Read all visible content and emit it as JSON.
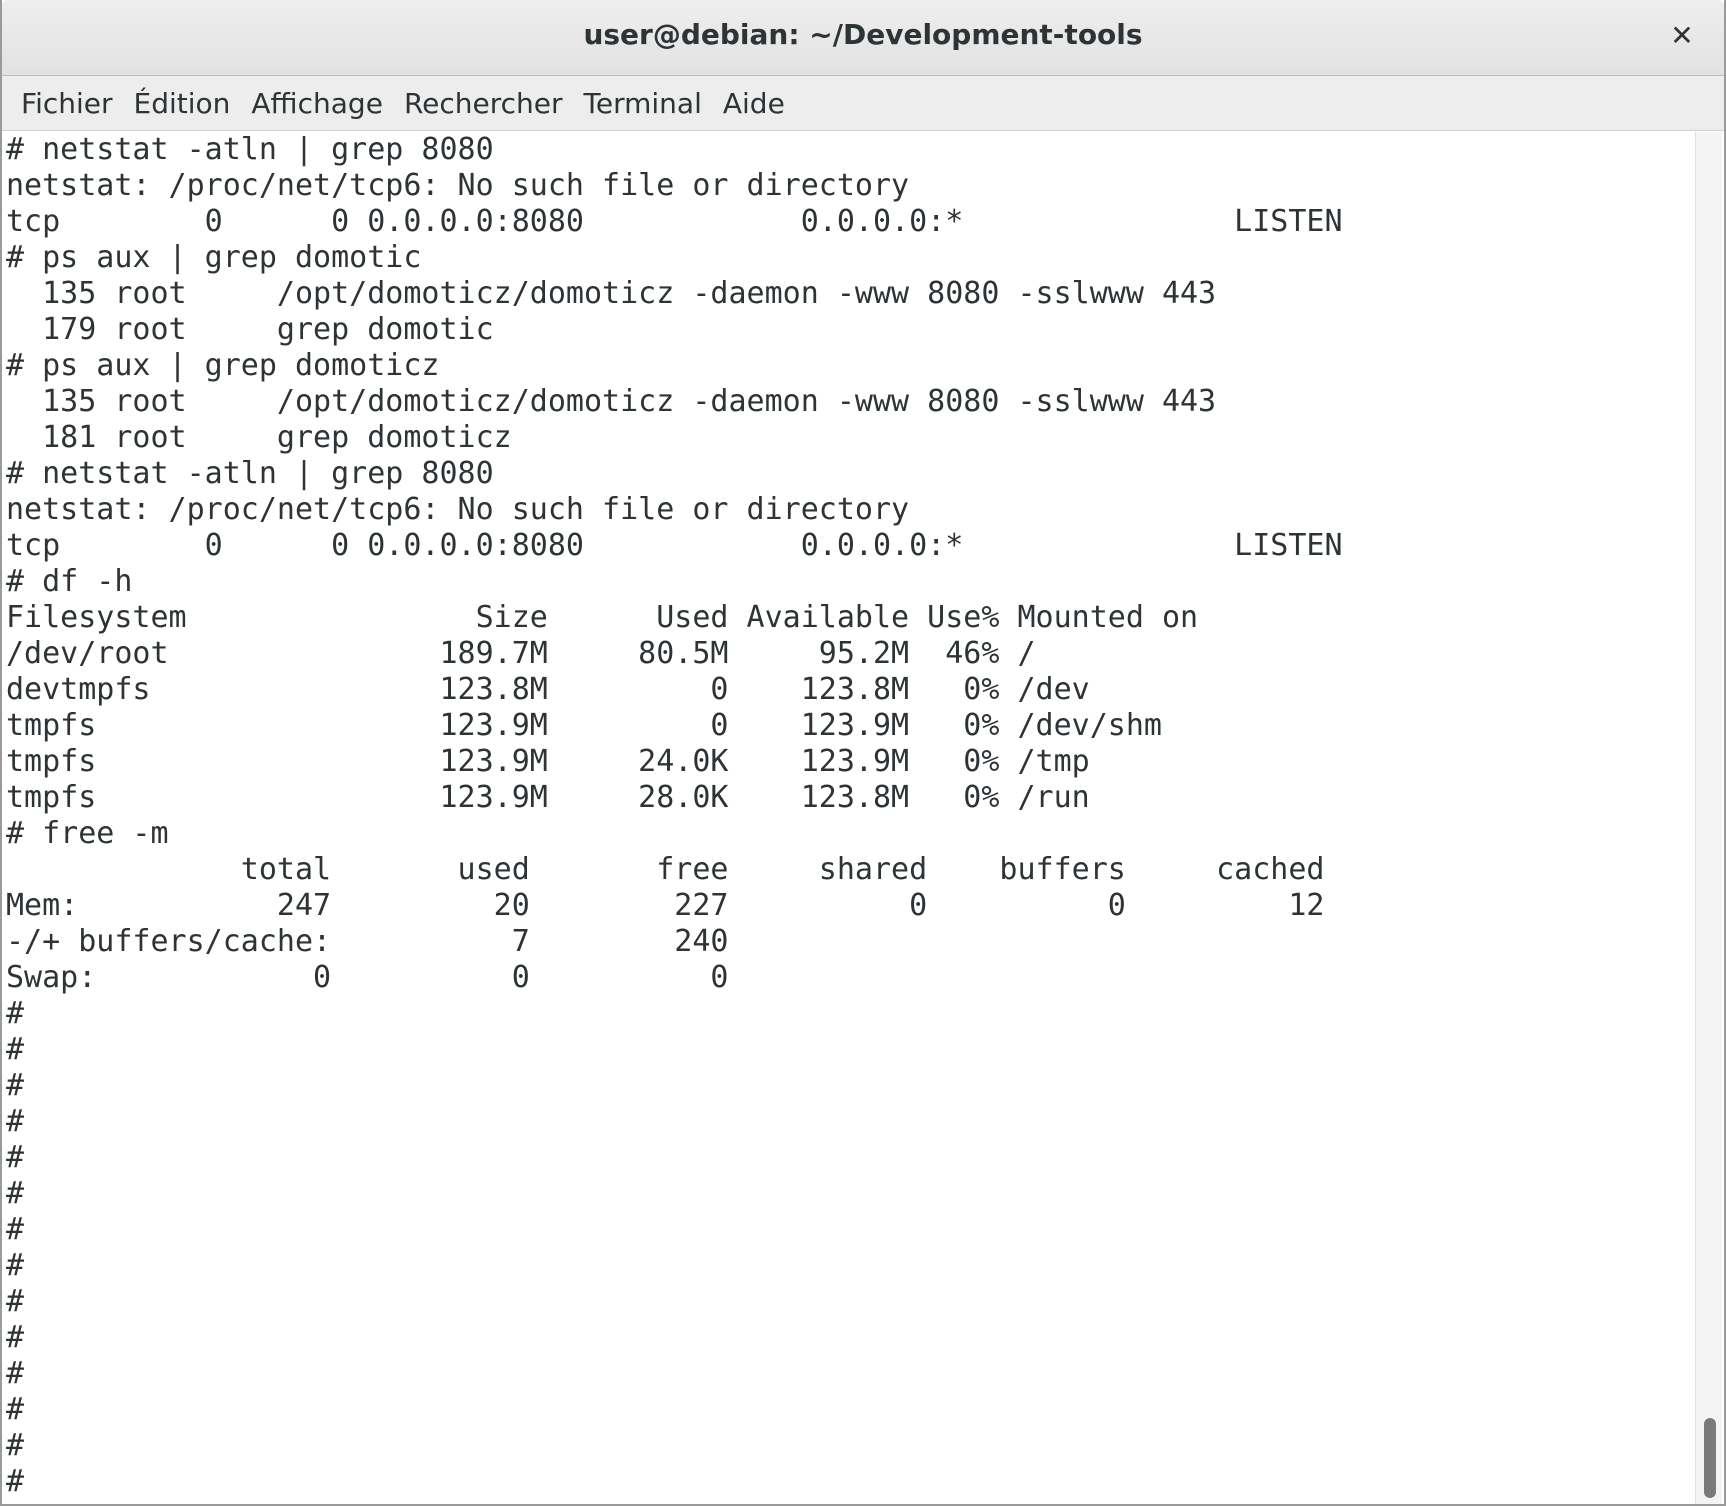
{
  "window": {
    "title": "user@debian: ~/Development-tools",
    "close_label": "✕"
  },
  "menubar": {
    "items": [
      "Fichier",
      "Édition",
      "Affichage",
      "Rechercher",
      "Terminal",
      "Aide"
    ]
  },
  "terminal": {
    "lines": [
      "# netstat -atln | grep 8080",
      "netstat: /proc/net/tcp6: No such file or directory",
      "tcp        0      0 0.0.0.0:8080            0.0.0.0:*               LISTEN",
      "# ps aux | grep domotic",
      "  135 root     /opt/domoticz/domoticz -daemon -www 8080 -sslwww 443",
      "  179 root     grep domotic",
      "# ps aux | grep domoticz",
      "  135 root     /opt/domoticz/domoticz -daemon -www 8080 -sslwww 443",
      "  181 root     grep domoticz",
      "# netstat -atln | grep 8080",
      "netstat: /proc/net/tcp6: No such file or directory",
      "tcp        0      0 0.0.0.0:8080            0.0.0.0:*               LISTEN",
      "# df -h",
      "Filesystem                Size      Used Available Use% Mounted on",
      "/dev/root               189.7M     80.5M     95.2M  46% /",
      "devtmpfs                123.8M         0    123.8M   0% /dev",
      "tmpfs                   123.9M         0    123.9M   0% /dev/shm",
      "tmpfs                   123.9M     24.0K    123.9M   0% /tmp",
      "tmpfs                   123.9M     28.0K    123.8M   0% /run",
      "# free -m",
      "             total       used       free     shared    buffers     cached",
      "Mem:           247         20        227          0          0         12",
      "-/+ buffers/cache:          7        240",
      "Swap:            0          0          0",
      "#",
      "#",
      "#",
      "#",
      "#",
      "#",
      "#",
      "#",
      "#",
      "#",
      "#",
      "#",
      "#",
      "#"
    ]
  }
}
